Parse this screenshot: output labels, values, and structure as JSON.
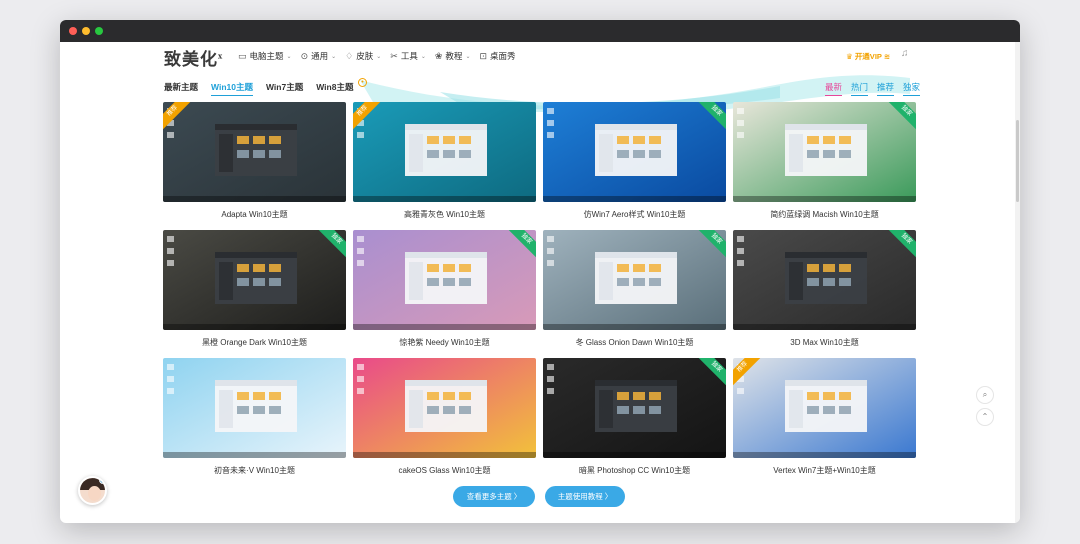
{
  "site": {
    "logo": "致美化",
    "logo_mark": "x"
  },
  "nav": [
    {
      "label": "电脑主题",
      "icon": "monitor-icon"
    },
    {
      "label": "通用",
      "icon": "compass-icon"
    },
    {
      "label": "皮肤",
      "icon": "shirt-icon"
    },
    {
      "label": "工具",
      "icon": "tools-icon"
    },
    {
      "label": "教程",
      "icon": "book-icon"
    },
    {
      "label": "桌面秀",
      "icon": "screen-icon"
    }
  ],
  "vip": {
    "label": "开通VIP",
    "icon": "crown-icon"
  },
  "tabs": [
    {
      "label": "最新主题",
      "active": false
    },
    {
      "label": "Win10主题",
      "active": true
    },
    {
      "label": "Win7主题",
      "active": false
    },
    {
      "label": "Win8主题",
      "active": false
    }
  ],
  "sort": [
    {
      "label": "最新",
      "active": true
    },
    {
      "label": "热门",
      "active": false
    },
    {
      "label": "推荐",
      "active": false
    },
    {
      "label": "独家",
      "active": false
    }
  ],
  "themes": [
    {
      "title": "Adapta Win10主题",
      "ribbon": "推荐",
      "ribbon_color": "#f2a200",
      "ribbon_side": "left",
      "palette": [
        "#3c4a52",
        "#2a3338"
      ]
    },
    {
      "title": "高雅青灰色 Win10主题",
      "ribbon": "推荐",
      "ribbon_color": "#f2a200",
      "ribbon_side": "left",
      "palette": [
        "#1a9bb8",
        "#0e6a80"
      ]
    },
    {
      "title": "仿Win7 Aero样式 Win10主题",
      "ribbon": "独家",
      "ribbon_color": "#20b26b",
      "ribbon_side": "right",
      "palette": [
        "#1e7fd6",
        "#0a4aa0"
      ]
    },
    {
      "title": "简约蓝绿调 Macish Win10主题",
      "ribbon": "独家",
      "ribbon_color": "#20b26b",
      "ribbon_side": "right",
      "palette": [
        "#e8e6da",
        "#3a9a5a"
      ]
    },
    {
      "title": "黑橙 Orange Dark Win10主题",
      "ribbon": "独家",
      "ribbon_color": "#20b26b",
      "ribbon_side": "right",
      "palette": [
        "#4a4a44",
        "#1e1e1c"
      ]
    },
    {
      "title": "惊艳紫 Needy Win10主题",
      "ribbon": "独家",
      "ribbon_color": "#20b26b",
      "ribbon_side": "right",
      "palette": [
        "#a98fd0",
        "#d89ab8"
      ]
    },
    {
      "title": "冬 Glass Onion Dawn Win10主题",
      "ribbon": "独家",
      "ribbon_color": "#20b26b",
      "ribbon_side": "right",
      "palette": [
        "#9fb2bd",
        "#5a6f7a"
      ]
    },
    {
      "title": "3D Max Win10主题",
      "ribbon": "独家",
      "ribbon_color": "#20b26b",
      "ribbon_side": "right",
      "palette": [
        "#4a4a4a",
        "#2a2a2a"
      ]
    },
    {
      "title": "初音未来·V Win10主题",
      "ribbon": "",
      "ribbon_color": "",
      "ribbon_side": "right",
      "palette": [
        "#8fd3f0",
        "#e8f4fb"
      ]
    },
    {
      "title": "cakeOS Glass Win10主题",
      "ribbon": "",
      "ribbon_color": "",
      "ribbon_side": "right",
      "palette": [
        "#e94a8a",
        "#f2c23a"
      ]
    },
    {
      "title": "暗黑 Photoshop CC Win10主题",
      "ribbon": "独家",
      "ribbon_color": "#20b26b",
      "ribbon_side": "right",
      "palette": [
        "#2a2a2a",
        "#141414"
      ]
    },
    {
      "title": "Vertex Win7主题+Win10主题",
      "ribbon": "推荐",
      "ribbon_color": "#f2a200",
      "ribbon_side": "left",
      "palette": [
        "#dfe3e8",
        "#3a78d0"
      ]
    }
  ],
  "buttons": {
    "more": "查看更多主题 〉",
    "tutorial": "主题使用教程 〉"
  }
}
